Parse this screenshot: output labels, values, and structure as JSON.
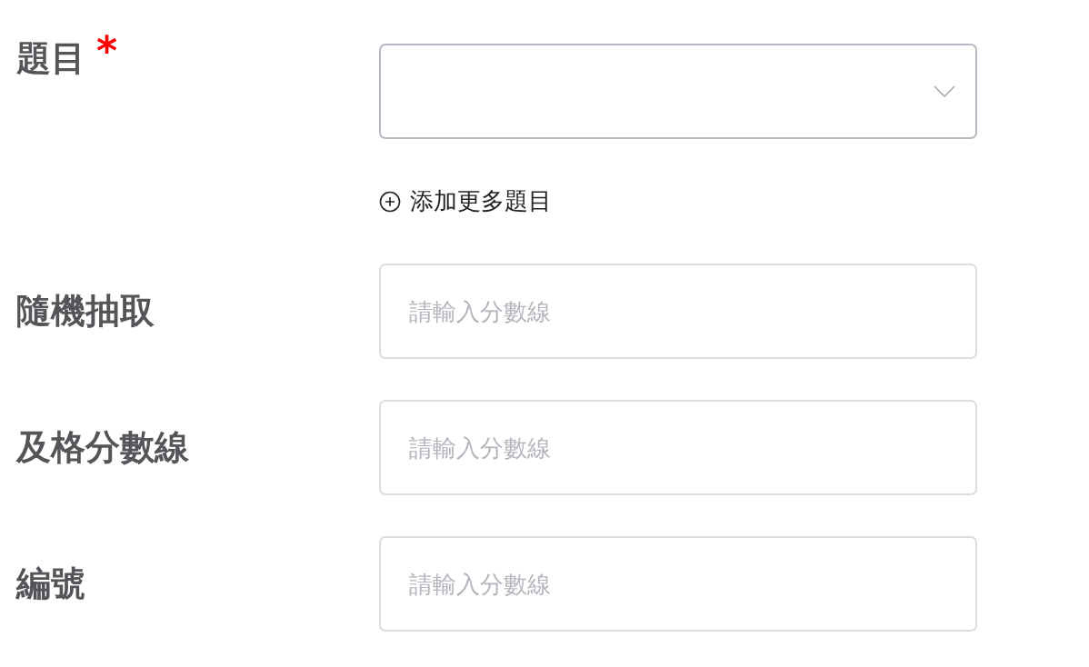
{
  "fields": [
    {
      "kind": "select",
      "label": "題目",
      "required_mark": "*"
    },
    {
      "kind": "add_link",
      "text": "添加更多題目"
    },
    {
      "kind": "input",
      "label": "隨機抽取",
      "placeholder": "請輸入分數線"
    },
    {
      "kind": "input",
      "label": "及格分數線",
      "placeholder": "請輸入分數線"
    },
    {
      "kind": "input",
      "label": "編號",
      "placeholder": "請輸入分數線"
    }
  ]
}
